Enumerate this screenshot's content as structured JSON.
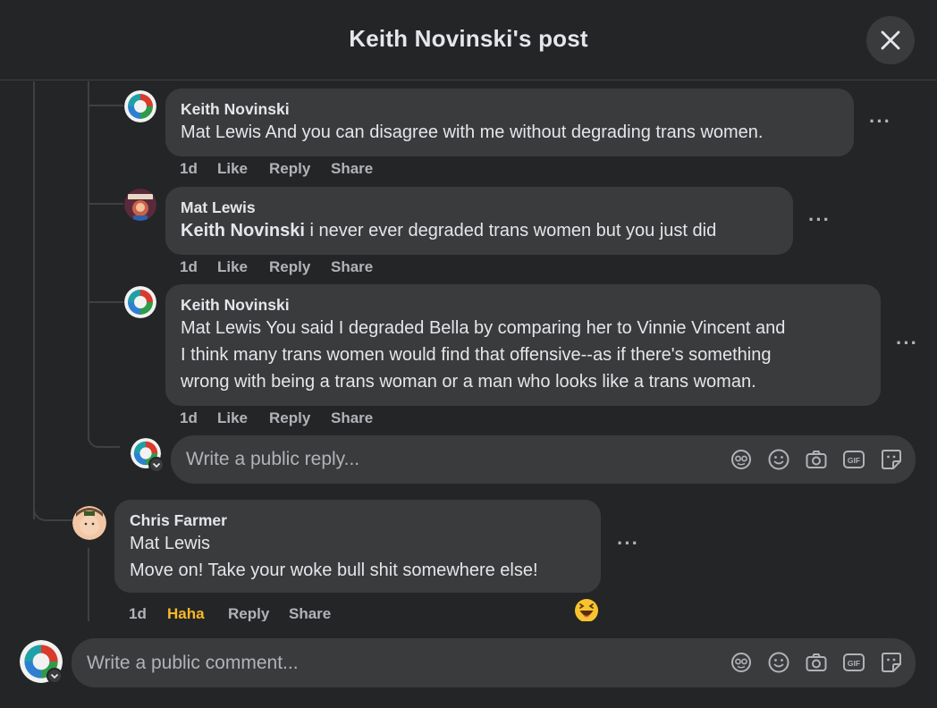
{
  "header": {
    "title": "Keith Novinski's post",
    "close_icon": "close-icon"
  },
  "replies": [
    {
      "author": "Keith Novinski",
      "mention": "Mat Lewis",
      "text": " And you can disagree with me without degrading trans women.",
      "time": "1d",
      "like": "Like",
      "reply": "Share"
    },
    {
      "author": "Mat Lewis",
      "mention": "Keith Novinski",
      "text": " i never ever degraded trans women but you just did",
      "time": "1d",
      "like": "Like",
      "reply": "Share"
    },
    {
      "author": "Keith Novinski",
      "mention": "Mat Lewis",
      "line1": " You said I degraded Bella by comparing her to Vinnie Vincent and",
      "line2": "I think many trans women would find that offensive--as if there's something",
      "line3": "wrong with being a trans woman or a man who looks like a trans woman.",
      "time": "1d",
      "like": "Like",
      "reply": "Share"
    }
  ],
  "actions": {
    "like": "Like",
    "reply": "Reply",
    "share": "Share",
    "more": "···"
  },
  "reply_input": {
    "placeholder": "Write a public reply..."
  },
  "top_comment": {
    "author": "Chris Farmer",
    "line1": "Mat Lewis",
    "line2": "Move on! Take your woke bull shit somewhere else!",
    "time": "1d",
    "reaction": "Haha",
    "reply": "Reply",
    "share": "Share",
    "reaction_emoji": "😝"
  },
  "comment_input": {
    "placeholder": "Write a public comment..."
  },
  "input_icons": [
    "avatar-sticker-icon",
    "emoji-icon",
    "camera-icon",
    "gif-icon",
    "sticker-icon"
  ],
  "colors": {
    "background": "#242526",
    "bubble": "#3a3b3c",
    "text": "#e4e6eb",
    "muted": "#b0b3b8",
    "haha": "#f7b928"
  }
}
